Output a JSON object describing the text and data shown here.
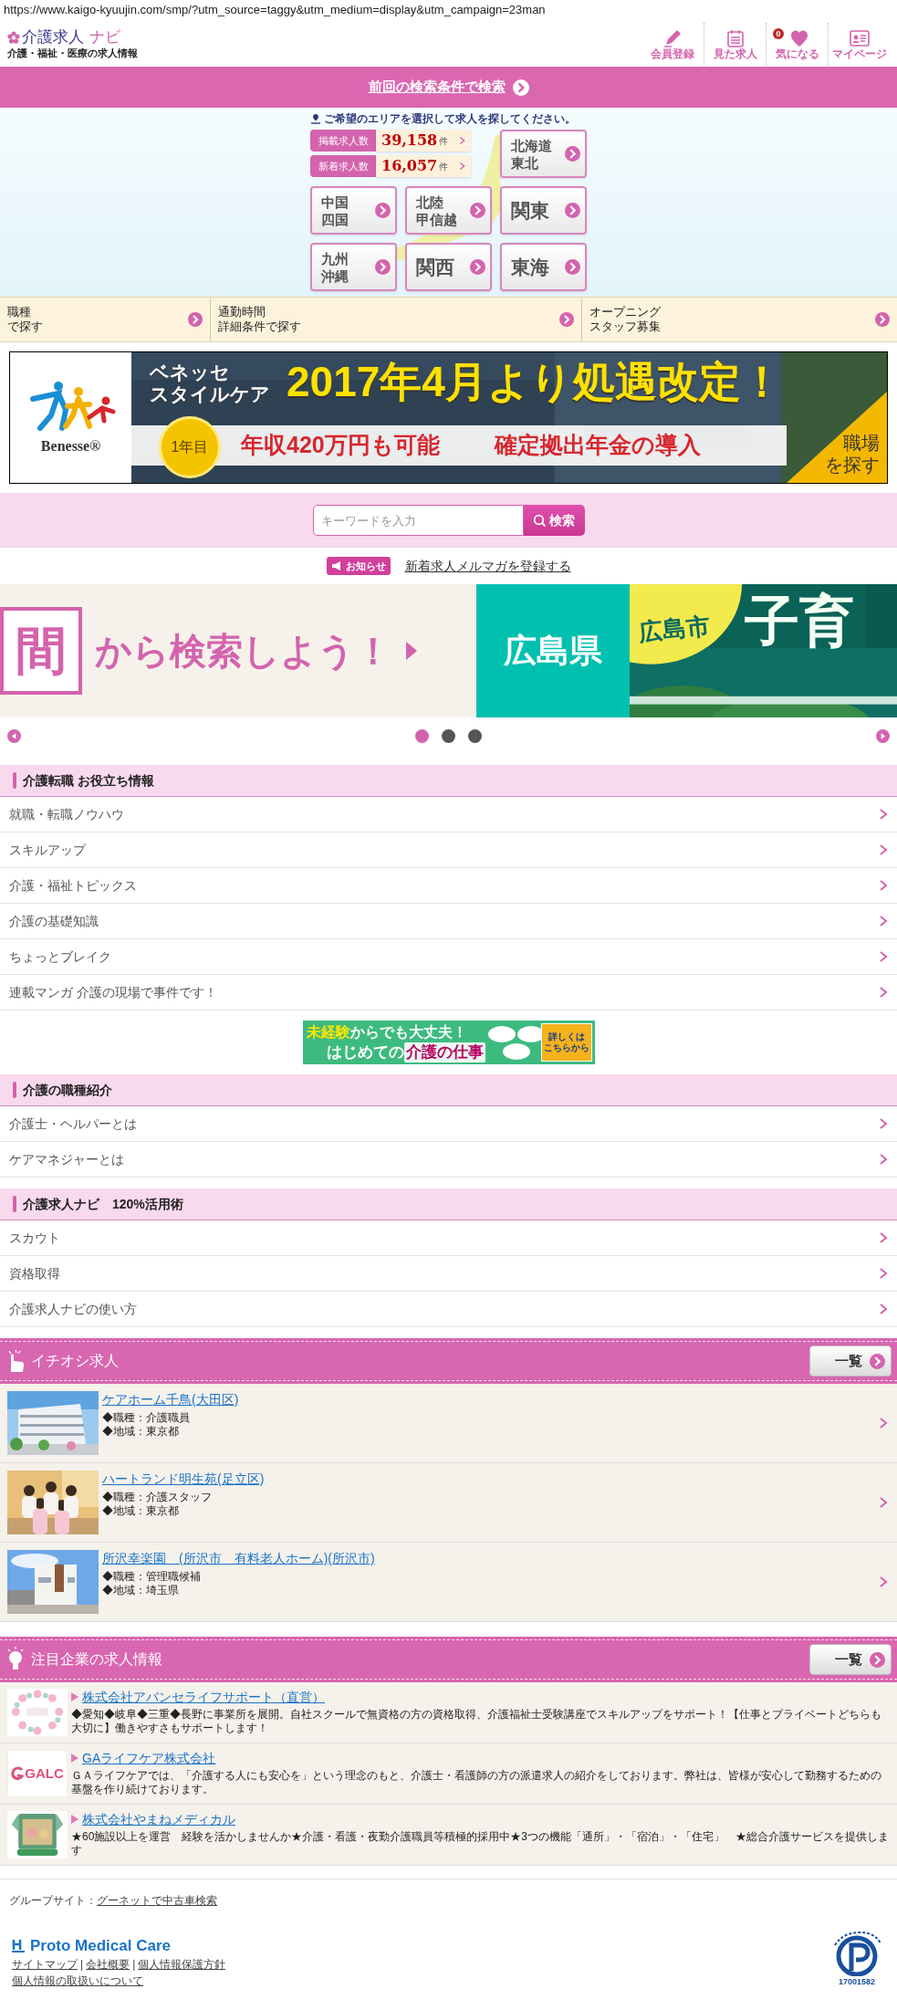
{
  "address_bar": {
    "url": "https://www.kaigo-kyuujin.com/smp/?utm_source=taggy&utm_medium=display&utm_campaign=23man"
  },
  "header": {
    "logo_main": "介護求人",
    "logo_accent": "ナビ",
    "tagline": "介護・福祉・医療の求人情報",
    "nav": [
      {
        "label": "会員登録"
      },
      {
        "label": "見た求人"
      },
      {
        "label": "気になる",
        "badge": "0"
      },
      {
        "label": "マイページ"
      }
    ]
  },
  "last_search": {
    "label": "前回の検索条件で検索"
  },
  "area_search": {
    "prompt": "ご希望のエリアを選択して求人を探してください。",
    "counts": [
      {
        "label": "掲載求人数",
        "value": "39,158",
        "unit": "件"
      },
      {
        "label": "新着求人数",
        "value": "16,057",
        "unit": "件"
      }
    ],
    "regions": [
      {
        "lines": [
          "北海道",
          "東北"
        ]
      },
      {
        "lines": [
          "中国",
          "四国"
        ]
      },
      {
        "lines": [
          "北陸",
          "甲信越"
        ]
      },
      {
        "lines": [
          "関東"
        ]
      },
      {
        "lines": [
          "九州",
          "沖縄"
        ]
      },
      {
        "lines": [
          "関西"
        ]
      },
      {
        "lines": [
          "東海"
        ]
      }
    ]
  },
  "quick_links": [
    {
      "lines": [
        "職種",
        "で探す"
      ]
    },
    {
      "lines": [
        "通勤時間",
        "詳細条件で探す"
      ]
    },
    {
      "lines": [
        "オープニング",
        "スタッフ募集"
      ]
    }
  ],
  "promo_banner": {
    "brand": "Benesse®",
    "brand_lines": [
      "ベネッセ",
      "スタイルケア"
    ],
    "headline": "2017年4月より処遇改定！",
    "badge": "1年目",
    "benefits": [
      "年収420万円も可能",
      "確定拠出年金の導入"
    ],
    "cta_lines": [
      "職場",
      "を探す"
    ]
  },
  "keyword_search": {
    "placeholder": "キーワードを入力",
    "button": "検索"
  },
  "notice": {
    "badge": "お知らせ",
    "link": "新着求人メルマガを登録する"
  },
  "carousel": {
    "slides": [
      {
        "kind": "keyword",
        "tile": "間",
        "caption": "から検索しよう！"
      },
      {
        "kind": "region",
        "title": "広島県"
      },
      {
        "kind": "feature",
        "city": "広島市",
        "title": "子育"
      }
    ],
    "dots": [
      {
        "selected": true
      },
      {
        "selected": false
      },
      {
        "selected": false
      }
    ]
  },
  "blocks": [
    {
      "kind": "menu",
      "title": "介護転職 お役立ち情報",
      "items": [
        "就職・転職ノウハウ",
        "スキルアップ",
        "介護・福祉トピックス",
        "介護の基礎知識",
        "ちょっとブレイク",
        "連載マンガ 介護の現場で事件です！"
      ]
    },
    {
      "kind": "banner",
      "lines": [
        [
          {
            "text": "未経験",
            "accent": true
          },
          {
            "text": "からでも大丈夫！",
            "accent": false
          }
        ],
        [
          {
            "text": "はじめての",
            "accent": false
          },
          {
            "text": "介護の仕事",
            "accent": true
          }
        ]
      ],
      "cta_lines": [
        "詳しくは",
        "こちらから"
      ]
    },
    {
      "kind": "menu",
      "title": "介護の職種紹介",
      "items": [
        "介護士・ヘルパーとは",
        "ケアマネジャーとは"
      ]
    },
    {
      "kind": "menu",
      "title": "介護求人ナビ　120%活用術",
      "items": [
        "スカウト",
        "資格取得",
        "介護求人ナビの使い方"
      ]
    }
  ],
  "featured_jobs": {
    "title": "イチオシ求人",
    "more": "一覧",
    "jobs": [
      {
        "name": "ケアホーム千鳥(大田区)",
        "job_type": "◆職種：介護職員",
        "area": "◆地域：東京都"
      },
      {
        "name": "ハートランド明生苑(足立区)",
        "job_type": "◆職種：介護スタッフ",
        "area": "◆地域：東京都"
      },
      {
        "name": "所沢幸楽園　(所沢市　有料老人ホーム)(所沢市)",
        "job_type": "◆職種：管理職候補",
        "area": "◆地域：埼玉県"
      }
    ]
  },
  "featured_companies": {
    "title": "注目企業の求人情報",
    "more": "一覧",
    "companies": [
      {
        "name": "株式会社アバンセライフサポート（直営）",
        "description": "◆愛知◆岐阜◆三重◆長野に事業所を展開。自社スクールで無資格の方の資格取得、介護福祉士受験講座でスキルアップをサポート！【仕事とプライベートどちらも大切に】働きやすさもサポートします！"
      },
      {
        "name": "GAライフケア株式会社",
        "logo_text": "GALC",
        "description": "ＧＡライフケアでは、「介護する人にも安心を」という理念のもと、介護士・看護師の方の派遣求人の紹介をしております。弊社は、皆様が安心して勤務するための基盤を作り続けております。"
      },
      {
        "name": "株式会社やまねメディカル",
        "description": "★60施設以上を運営　経験を活かしませんか★介護・看護・夜勤介護職員等積極的採用中★3つの機能「通所」・「宿泊」・「住宅」　★総合介護サービスを提供します"
      }
    ]
  },
  "footer": {
    "group_label": "グループサイト：",
    "group_link": "グーネットで中古車検索",
    "brand": "Proto Medical Care",
    "links": [
      "サイトマップ",
      "会社概要",
      "個人情報保護方針",
      "個人情報の取扱いについて"
    ],
    "separator": "|",
    "certification_number": "17001582"
  }
}
